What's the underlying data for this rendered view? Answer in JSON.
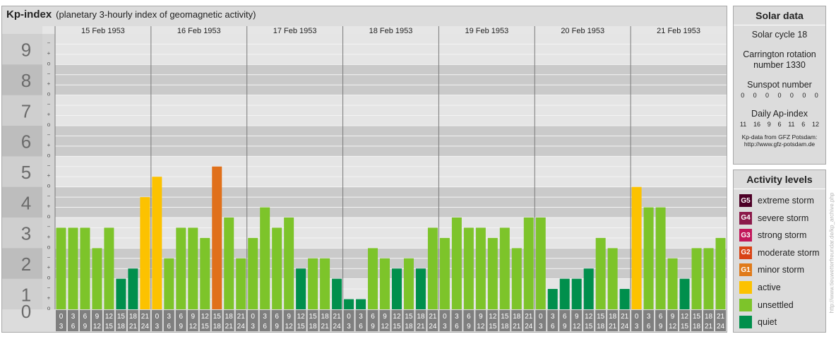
{
  "header": {
    "title": "Kp-index",
    "subtitle": "(planetary 3-hourly index of geomagnetic activity)"
  },
  "chart_data": {
    "type": "bar",
    "ylim": [
      0,
      9
    ],
    "y_ticks": [
      "0",
      "1",
      "2",
      "3",
      "4",
      "5",
      "6",
      "7",
      "8",
      "9"
    ],
    "minor_tick_labels": [
      "o",
      "+",
      "−"
    ],
    "days": [
      "15 Feb 1953",
      "16 Feb 1953",
      "17 Feb 1953",
      "18 Feb 1953",
      "19 Feb 1953",
      "20 Feb 1953",
      "21 Feb 1953"
    ],
    "interval_labels": [
      [
        "0",
        "3"
      ],
      [
        "3",
        "6"
      ],
      [
        "6",
        "9"
      ],
      [
        "9",
        "12"
      ],
      [
        "12",
        "15"
      ],
      [
        "15",
        "18"
      ],
      [
        "18",
        "21"
      ],
      [
        "21",
        "24"
      ]
    ],
    "values": [
      2.667,
      2.667,
      2.667,
      2.0,
      2.667,
      1.0,
      1.333,
      3.667,
      4.333,
      1.667,
      2.667,
      2.667,
      2.333,
      4.667,
      3.0,
      1.667,
      2.333,
      3.333,
      2.667,
      3.0,
      1.333,
      1.667,
      1.667,
      1.0,
      0.333,
      0.333,
      2.0,
      1.667,
      1.333,
      1.667,
      1.333,
      2.667,
      2.333,
      3.0,
      2.667,
      2.667,
      2.333,
      2.667,
      2.0,
      3.0,
      3.0,
      0.667,
      1.0,
      1.0,
      1.333,
      2.333,
      2.0,
      0.667,
      4.0,
      3.333,
      3.333,
      1.667,
      1.0,
      2.0,
      2.0,
      2.333
    ],
    "bar_categories": [
      "unsettled",
      "unsettled",
      "unsettled",
      "unsettled",
      "unsettled",
      "quiet",
      "quiet",
      "active",
      "active",
      "unsettled",
      "unsettled",
      "unsettled",
      "unsettled",
      "moderate storm",
      "unsettled",
      "unsettled",
      "unsettled",
      "unsettled",
      "unsettled",
      "unsettled",
      "quiet",
      "unsettled",
      "unsettled",
      "quiet",
      "quiet",
      "quiet",
      "unsettled",
      "unsettled",
      "quiet",
      "unsettled",
      "quiet",
      "unsettled",
      "unsettled",
      "unsettled",
      "unsettled",
      "unsettled",
      "unsettled",
      "unsettled",
      "unsettled",
      "unsettled",
      "unsettled",
      "quiet",
      "quiet",
      "quiet",
      "quiet",
      "unsettled",
      "unsettled",
      "quiet",
      "active",
      "unsettled",
      "unsettled",
      "unsettled",
      "quiet",
      "unsettled",
      "unsettled",
      "unsettled"
    ],
    "colors": {
      "quiet": "#008f4c",
      "unsettled": "#7dc42a",
      "active": "#fcc200",
      "minor storm": "#e07b1b",
      "moderate storm": "#e0701b"
    }
  },
  "solar": {
    "title": "Solar data",
    "cycle": "Solar cycle 18",
    "carrington_1": "Carrington rotation",
    "carrington_2": "number 1330",
    "sunspot_label": "Sunspot number",
    "sunspot_values": [
      "0",
      "0",
      "0",
      "0",
      "0",
      "0",
      "0"
    ],
    "ap_label": "Daily Ap-index",
    "ap_values": [
      "11",
      "16",
      "9",
      "6",
      "11",
      "6",
      "12"
    ],
    "note_1": "Kp-data from GFZ Potsdam:",
    "note_2": "http://www.gfz-potsdam.de"
  },
  "activity": {
    "title": "Activity levels",
    "levels": [
      {
        "badge": "G5",
        "label": "extreme storm",
        "color": "#4d0026"
      },
      {
        "badge": "G4",
        "label": "severe storm",
        "color": "#8b1a4a"
      },
      {
        "badge": "G3",
        "label": "strong storm",
        "color": "#c2185b"
      },
      {
        "badge": "G2",
        "label": "moderate storm",
        "color": "#d84315"
      },
      {
        "badge": "G1",
        "label": "minor storm",
        "color": "#e07b1b"
      },
      {
        "badge": "",
        "label": "active",
        "color": "#fcc200"
      },
      {
        "badge": "",
        "label": "unsettled",
        "color": "#7dc42a"
      },
      {
        "badge": "",
        "label": "quiet",
        "color": "#008f4c"
      }
    ]
  },
  "watermark": "http://www.tieuwetterfreundar.de/kp_archive.php"
}
